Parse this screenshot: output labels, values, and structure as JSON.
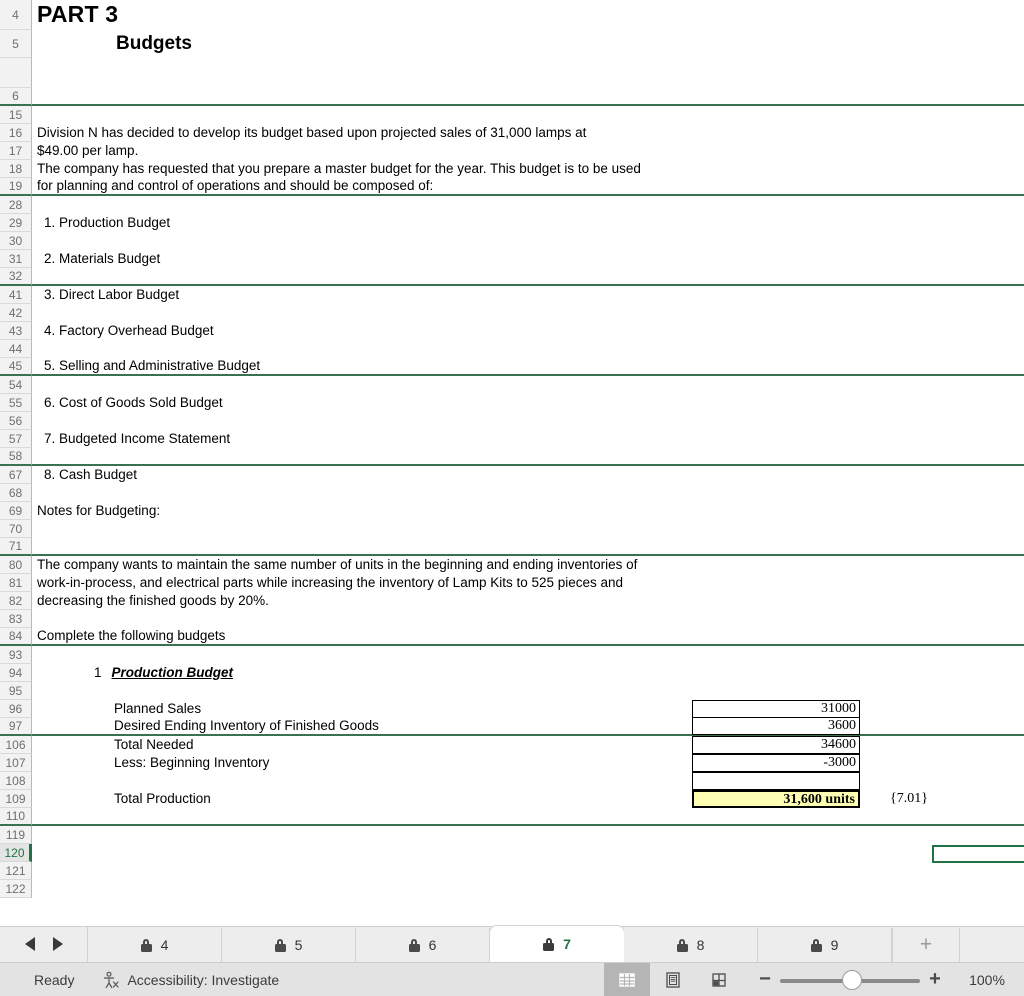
{
  "grid": {
    "rows": [
      {
        "num": "4",
        "text": "PART 3",
        "style": "big"
      },
      {
        "num": "5",
        "text": "Budgets",
        "style": "big2"
      },
      {
        "num": "",
        "text": "",
        "style": "plain",
        "blank_top": true
      },
      {
        "num": "6",
        "text": "",
        "style": "plain",
        "break_after": true
      },
      {
        "num": "15",
        "text": "",
        "style": "plain"
      },
      {
        "num": "16",
        "text": "Division N has decided to develop its budget based upon projected sales of 31,000 lamps at",
        "style": "plain"
      },
      {
        "num": "17",
        "text": "$49.00  per lamp.",
        "style": "plain"
      },
      {
        "num": "18",
        "text": "The company has requested that you prepare a master budget for the year.  This budget is to be used",
        "style": "plain"
      },
      {
        "num": "19",
        "text": "for planning and control of operations and should be composed of:",
        "style": "plain",
        "break_after": true
      },
      {
        "num": "28",
        "text": "",
        "style": "plain"
      },
      {
        "num": "29",
        "text": "1.  Production Budget",
        "style": "ind1"
      },
      {
        "num": "30",
        "text": "",
        "style": "plain"
      },
      {
        "num": "31",
        "text": "2.  Materials Budget",
        "style": "ind1"
      },
      {
        "num": "32",
        "text": "",
        "style": "plain",
        "break_after": true
      },
      {
        "num": "41",
        "text": "3.  Direct Labor Budget",
        "style": "ind1"
      },
      {
        "num": "42",
        "text": "",
        "style": "plain"
      },
      {
        "num": "43",
        "text": "4.  Factory Overhead Budget",
        "style": "ind1"
      },
      {
        "num": "44",
        "text": "",
        "style": "plain"
      },
      {
        "num": "45",
        "text": "5.  Selling and Administrative Budget",
        "style": "ind1",
        "break_after": true
      },
      {
        "num": "54",
        "text": "",
        "style": "plain"
      },
      {
        "num": "55",
        "text": "6.  Cost of Goods Sold Budget",
        "style": "ind1"
      },
      {
        "num": "56",
        "text": "",
        "style": "plain"
      },
      {
        "num": "57",
        "text": "7.  Budgeted Income Statement",
        "style": "ind1"
      },
      {
        "num": "58",
        "text": "",
        "style": "plain",
        "break_after": true
      },
      {
        "num": "67",
        "text": "8.  Cash Budget",
        "style": "ind1"
      },
      {
        "num": "68",
        "text": "",
        "style": "plain"
      },
      {
        "num": "69",
        "text": "Notes for Budgeting:",
        "style": "plain"
      },
      {
        "num": "70",
        "text": "",
        "style": "plain"
      },
      {
        "num": "71",
        "text": "",
        "style": "plain",
        "break_after": true
      },
      {
        "num": "80",
        "text": "The company wants to maintain the same number of units in the beginning and ending inventories of",
        "style": "plain"
      },
      {
        "num": "81",
        "text": "work-in-process, and electrical parts  while increasing the inventory of Lamp Kits to 525 pieces and",
        "style": "plain"
      },
      {
        "num": "82",
        "text": "decreasing the finished goods by 20%.",
        "style": "plain"
      },
      {
        "num": "83",
        "text": "",
        "style": "plain"
      },
      {
        "num": "84",
        "text": "Complete the following budgets",
        "style": "plain",
        "break_after": true
      },
      {
        "num": "93",
        "text": "",
        "style": "plain"
      },
      {
        "num": "94",
        "text": "Production Budget",
        "style": "heading-num",
        "lead_num": "1"
      },
      {
        "num": "95",
        "text": "",
        "style": "plain"
      },
      {
        "num": "96",
        "text": "Planned Sales",
        "style": "ind3",
        "value": "31000"
      },
      {
        "num": "97",
        "text": "Desired Ending Inventory of Finished Goods",
        "style": "ind3",
        "value": "3600",
        "break_after": true
      },
      {
        "num": "106",
        "text": "Total Needed",
        "style": "ind3",
        "value": "34600"
      },
      {
        "num": "107",
        "text": " Less: Beginning Inventory",
        "style": "ind3",
        "value": "-3000"
      },
      {
        "num": "108",
        "text": "",
        "style": "plain",
        "value": ""
      },
      {
        "num": "109",
        "text": "Total Production",
        "style": "ind3",
        "value": "31,600 units",
        "value_total": true,
        "note": "{7.01}"
      },
      {
        "num": "110",
        "text": "",
        "style": "plain",
        "break_after": true
      },
      {
        "num": "119",
        "text": "",
        "style": "plain"
      },
      {
        "num": "120",
        "text": "",
        "style": "plain",
        "selected": true,
        "selbox": true
      },
      {
        "num": "121",
        "text": "",
        "style": "plain"
      },
      {
        "num": "122",
        "text": "",
        "style": "plain"
      }
    ]
  },
  "tabbar": {
    "prev_label": "◀",
    "next_label": "▶",
    "add_label": "+",
    "tabs": [
      {
        "label": "4",
        "locked": true,
        "active": false
      },
      {
        "label": "5",
        "locked": true,
        "active": false
      },
      {
        "label": "6",
        "locked": true,
        "active": false
      },
      {
        "label": "7",
        "locked": true,
        "active": true
      },
      {
        "label": "8",
        "locked": true,
        "active": false
      },
      {
        "label": "9",
        "locked": true,
        "active": false
      }
    ]
  },
  "statusbar": {
    "ready": "Ready",
    "accessibility": "Accessibility: Investigate",
    "views": [
      {
        "name": "normal-view",
        "active": true
      },
      {
        "name": "page-layout-view",
        "active": false
      },
      {
        "name": "page-break-view",
        "active": false
      }
    ],
    "zoom_out": "−",
    "zoom_in": "+",
    "zoom_level": "100%"
  },
  "colors": {
    "accent_green": "#217346",
    "break_line": "#3c7050",
    "total_fill": "#ffffb4",
    "header_bg": "#f2f2f2"
  }
}
